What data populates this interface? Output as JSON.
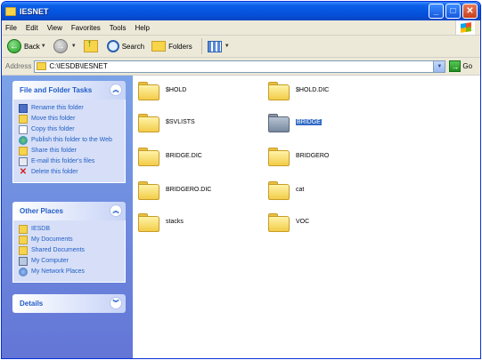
{
  "window": {
    "title": "IESNET",
    "buttons": [
      "_",
      "□",
      "✕"
    ]
  },
  "menu": [
    "File",
    "Edit",
    "View",
    "Favorites",
    "Tools",
    "Help"
  ],
  "toolbar": {
    "back_label": "Back",
    "search_label": "Search",
    "folders_label": "Folders"
  },
  "address": {
    "label": "Address",
    "path": "C:\\IESDB\\IESNET",
    "go_label": "Go"
  },
  "tasks_panel": {
    "title": "File and Folder Tasks",
    "items": [
      {
        "label": "Rename this folder",
        "icon": "rename-icon"
      },
      {
        "label": "Move this folder",
        "icon": "move-icon"
      },
      {
        "label": "Copy this folder",
        "icon": "copy-icon"
      },
      {
        "label": "Publish this folder to the Web",
        "icon": "publish-web-icon"
      },
      {
        "label": "Share this folder",
        "icon": "share-icon"
      },
      {
        "label": "E-mail this folder's files",
        "icon": "email-icon"
      },
      {
        "label": "Delete this folder",
        "icon": "delete-icon"
      }
    ]
  },
  "places_panel": {
    "title": "Other Places",
    "items": [
      {
        "label": "IESDB",
        "icon": "folder-icon"
      },
      {
        "label": "My Documents",
        "icon": "my-documents-icon"
      },
      {
        "label": "Shared Documents",
        "icon": "shared-documents-icon"
      },
      {
        "label": "My Computer",
        "icon": "my-computer-icon"
      },
      {
        "label": "My Network Places",
        "icon": "network-places-icon"
      }
    ]
  },
  "details_panel": {
    "title": "Details"
  },
  "folders": [
    {
      "name": "$HOLD",
      "selected": false
    },
    {
      "name": "$HOLD.DIC",
      "selected": false
    },
    {
      "name": "$SVLISTS",
      "selected": false
    },
    {
      "name": "BRIDGE",
      "selected": true
    },
    {
      "name": "BRIDGE.DIC",
      "selected": false
    },
    {
      "name": "BRIDGERO",
      "selected": false
    },
    {
      "name": "BRIDGERO.DIC",
      "selected": false
    },
    {
      "name": "cat",
      "selected": false
    },
    {
      "name": "stacks",
      "selected": false
    },
    {
      "name": "VOC",
      "selected": false
    }
  ],
  "colors": {
    "titlebar": "#0553dd",
    "taskpane": "#7ba2e7",
    "link": "#215dc6",
    "selection": "#316ac5"
  }
}
